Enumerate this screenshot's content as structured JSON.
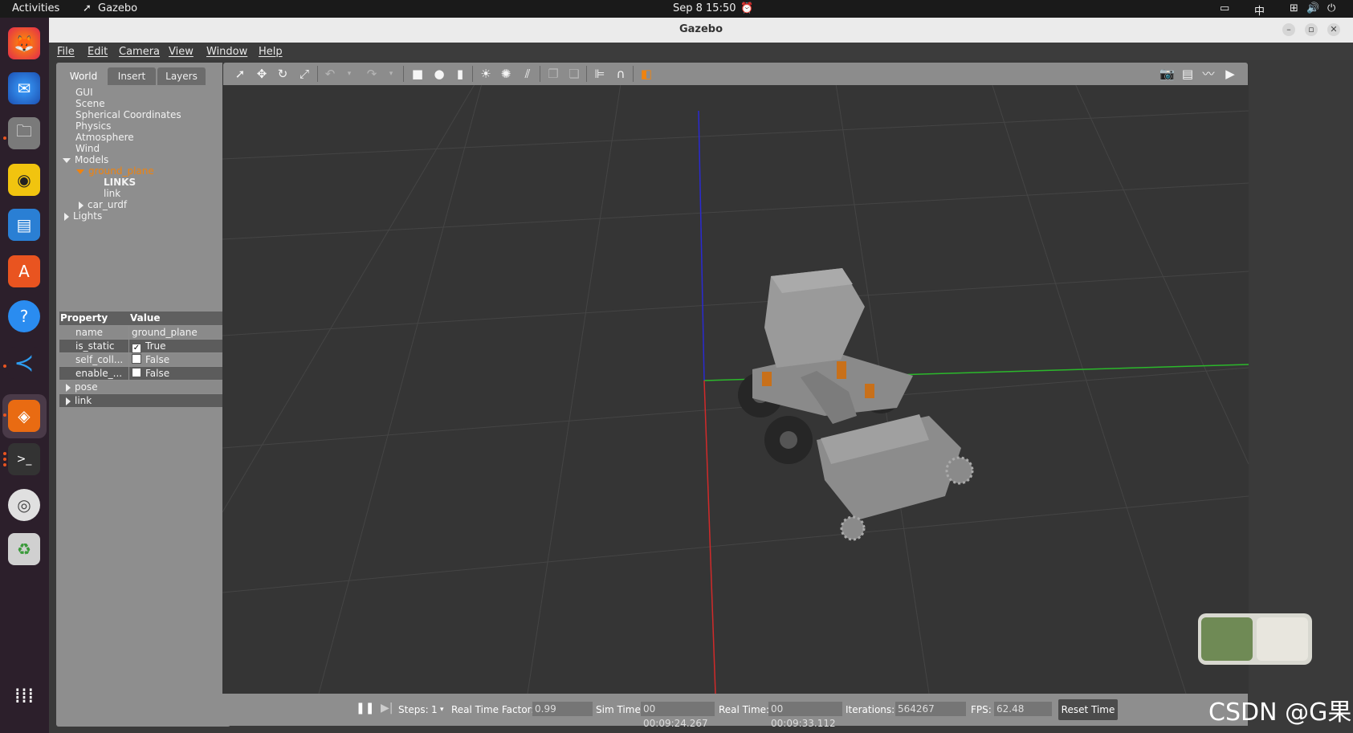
{
  "topbar": {
    "activities": "Activities",
    "app_name": "Gazebo",
    "clock": "Sep 8  15:50",
    "ime": "中"
  },
  "window": {
    "title": "Gazebo"
  },
  "menu": [
    "File",
    "Edit",
    "Camera",
    "View",
    "Window",
    "Help"
  ],
  "left_tabs": [
    "World",
    "Insert",
    "Layers"
  ],
  "tree": {
    "gui": "GUI",
    "scene": "Scene",
    "spherical": "Spherical Coordinates",
    "physics": "Physics",
    "atmosphere": "Atmosphere",
    "wind": "Wind",
    "models": "Models",
    "ground_plane": "ground_plane",
    "links": "LINKS",
    "link": "link",
    "car_urdf": "car_urdf",
    "lights": "Lights"
  },
  "properties": {
    "header_property": "Property",
    "header_value": "Value",
    "rows": [
      {
        "key": "name",
        "value": "ground_plane"
      },
      {
        "key": "is_static",
        "value": "True",
        "checked": true
      },
      {
        "key": "self_coll...",
        "value": "False",
        "checked": false
      },
      {
        "key": "enable_...",
        "value": "False",
        "checked": false
      }
    ],
    "pose": "pose",
    "link": "link"
  },
  "status": {
    "steps_label": "Steps:",
    "steps_value": "1",
    "rtf_label": "Real Time Factor:",
    "rtf_value": "0.99",
    "sim_label": "Sim Time:",
    "sim_value": "00 00:09:24.267",
    "real_label": "Real Time:",
    "real_value": "00 00:09:33.112",
    "iter_label": "Iterations:",
    "iter_value": "564267",
    "fps_label": "FPS:",
    "fps_value": "62.48",
    "reset": "Reset Time"
  },
  "watermark": "CSDN @G果",
  "colors": {
    "accent": "#f0830e",
    "axis_x": "#d12a2a",
    "axis_y": "#2bb82b",
    "axis_z": "#2a2ad1"
  }
}
